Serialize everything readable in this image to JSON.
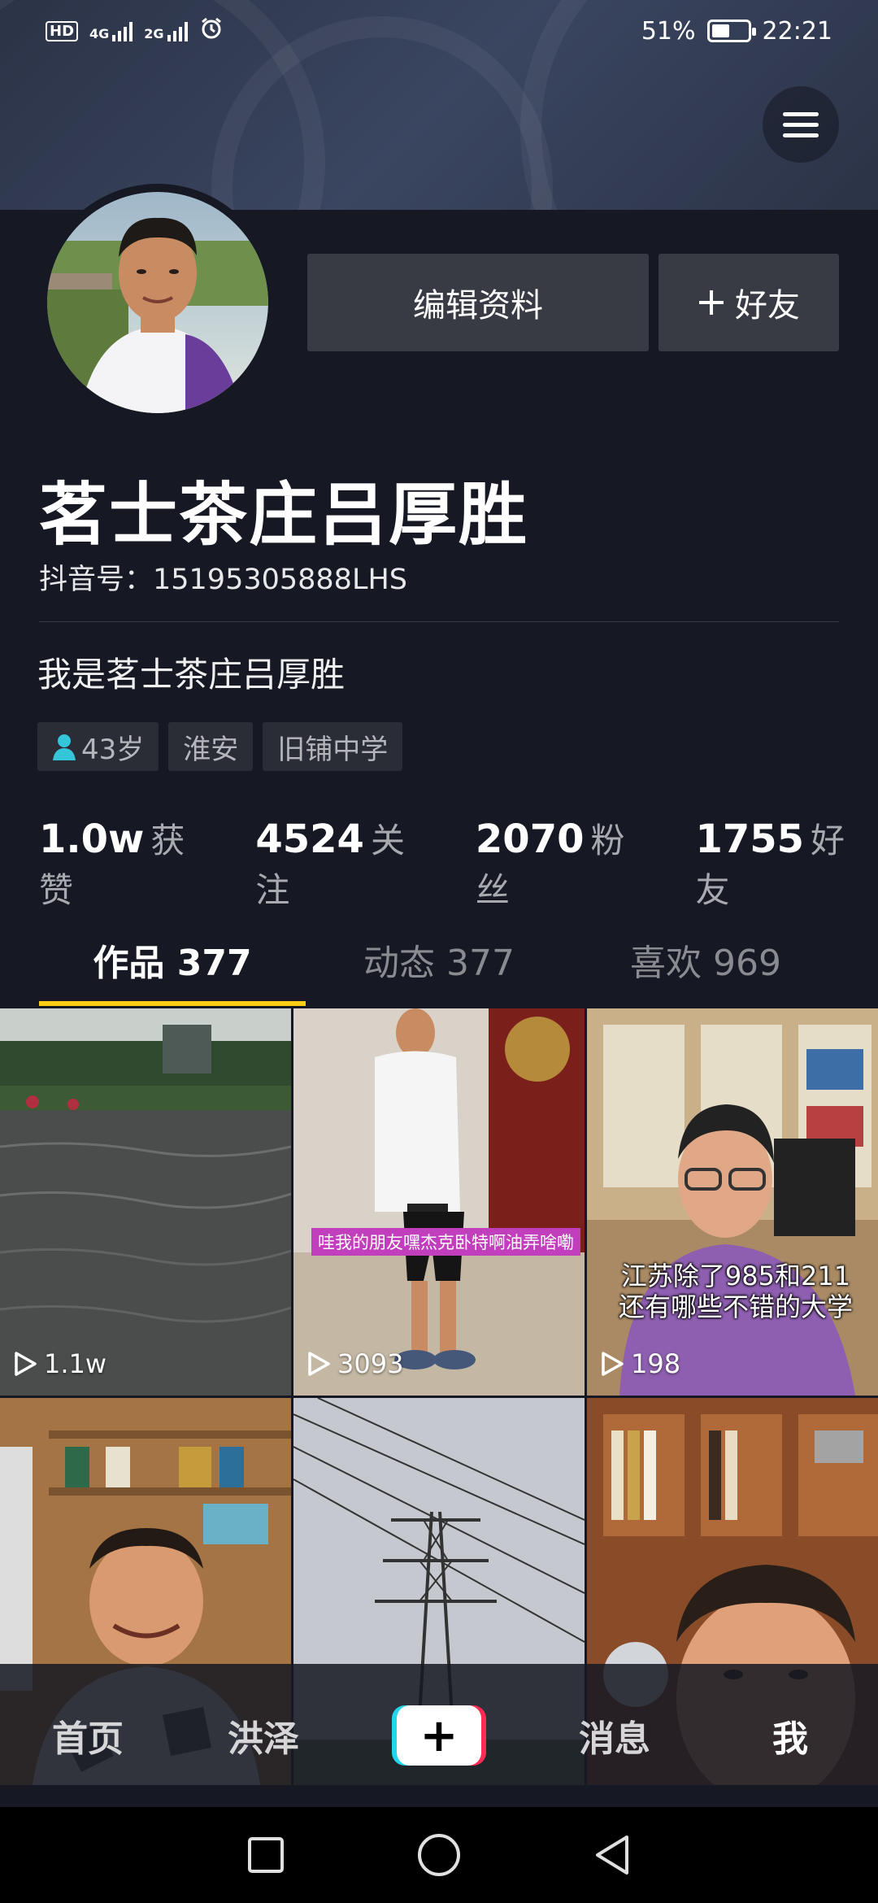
{
  "status_bar": {
    "left_labels": [
      "HD",
      "4G",
      "2G"
    ],
    "battery_percent": "51%",
    "battery_level": 0.51,
    "time": "22:21",
    "icons": [
      "hd-icon",
      "signal-4g-icon",
      "signal-2g-icon",
      "alarm-icon",
      "battery-icon"
    ]
  },
  "header": {
    "menu_icon": "hamburger-menu-icon"
  },
  "profile": {
    "avatar_icon": "avatar",
    "edit_button": "编辑资料",
    "add_friend_button": "好友",
    "add_friend_icon": "plus-icon",
    "nickname": "茗士茶庄吕厚胜",
    "douyin_id": "抖音号：15195305888LHS",
    "bio": "我是茗士茶庄吕厚胜",
    "tags": [
      "43岁",
      "淮安",
      "旧铺中学"
    ],
    "tag_icon": "person-icon"
  },
  "stats": [
    {
      "num": "1.0w",
      "label": "获赞"
    },
    {
      "num": "4524",
      "label": "关注"
    },
    {
      "num": "2070",
      "label": "粉丝"
    },
    {
      "num": "1755",
      "label": "好友"
    }
  ],
  "tabs": [
    {
      "label": "作品 377",
      "active": true
    },
    {
      "label": "动态 377",
      "active": false
    },
    {
      "label": "喜欢 969",
      "active": false
    }
  ],
  "videos": [
    {
      "plays": "1.1w",
      "caption": ""
    },
    {
      "plays": "3093",
      "caption": "哇我的朋友嘿杰克卧特啊油弄啥嘞"
    },
    {
      "plays": "198",
      "caption_line1": "江苏除了985和211",
      "caption_line2": "还有哪些不错的大学"
    },
    {
      "plays": "",
      "caption": ""
    },
    {
      "plays": "",
      "caption": ""
    },
    {
      "plays": "",
      "caption": ""
    }
  ],
  "bottom_nav": {
    "items": [
      "首页",
      "洪泽",
      "消息",
      "我"
    ],
    "plus_label": "+",
    "active": "我"
  },
  "system_nav": [
    "recent-apps-icon",
    "home-icon",
    "back-icon"
  ],
  "colors": {
    "background": "#161823",
    "button": "#393b44",
    "tab_indicator": "#face15",
    "accent_cyan": "#20d5ec",
    "accent_red": "#fe2c55"
  }
}
